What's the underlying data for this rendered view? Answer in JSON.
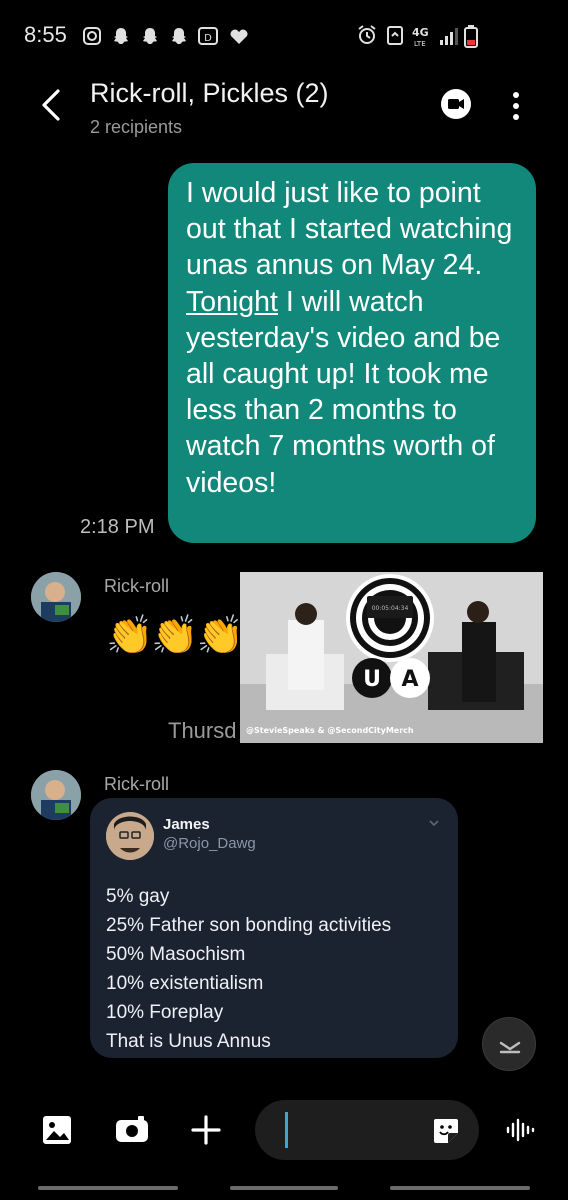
{
  "status_bar": {
    "time": "8:55",
    "left_icons": [
      "instagram-icon",
      "snapchat-icon",
      "snapchat-icon",
      "snapchat-icon",
      "disney-plus-icon",
      "heart-icon"
    ],
    "right_icons": [
      "alarm-icon",
      "recycle-icon",
      "4g-lte-icon",
      "signal-icon",
      "battery-low-icon"
    ]
  },
  "header": {
    "title": "Rick-roll, Pickles (2)",
    "subtitle": "2 recipients"
  },
  "messages": {
    "outgoing": {
      "text_before": "I would just like to point out that I started watching unas annus on May 24. ",
      "underlined": "Tonight",
      "text_after": " I will watch yesterday's video and be all caught up! It took me less than 2 months to watch 7 months worth of videos!",
      "time": "2:18 PM"
    },
    "incoming1": {
      "sender": "Rick-roll",
      "emoji": "👏👏👏",
      "media_caption": "@StevieSpeaks & @SecondCityMerch",
      "media_screen": "00:05:04:34",
      "timestamp_partial": "Thursd"
    },
    "incoming2": {
      "sender": "Rick-roll",
      "tweet": {
        "name": "James",
        "handle": "@Rojo_Dawg",
        "lines": [
          "5% gay",
          "25% Father son bonding activities",
          "50% Masochism",
          "10% existentialism",
          "10% Foreplay",
          "That is Unus Annus"
        ]
      }
    }
  },
  "colors": {
    "outgoing_bubble": "#11887a",
    "tweet_card": "#1b2230",
    "caret": "#3aa7d8"
  }
}
